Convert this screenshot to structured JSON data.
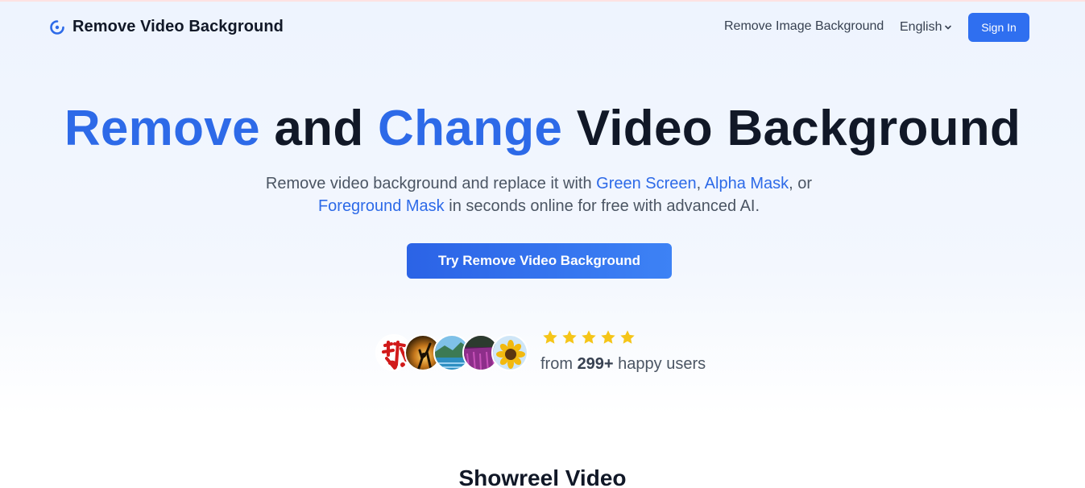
{
  "header": {
    "brand": "Remove Video Background",
    "nav_link": "Remove Image Background",
    "language": "English",
    "sign_in": "Sign In"
  },
  "hero": {
    "title_word1": "Remove",
    "title_word2": " and ",
    "title_word3": "Change",
    "title_word4": " Video Background",
    "sub_part1": "Remove video background and replace it with ",
    "link_green": "Green Screen",
    "sub_part2": ", ",
    "link_alpha": "Alpha Mask",
    "sub_part3": ", or ",
    "link_foreground": "Foreground Mask",
    "sub_part4": " in seconds online for free with advanced AI.",
    "cta": "Try Remove Video Background"
  },
  "social_proof": {
    "rating_stars": 5,
    "from": "from ",
    "count": "299+",
    "suffix": " happy users",
    "avatars": [
      "red-calligraphy-avatar",
      "sunset-silhouette-avatar",
      "lake-landscape-avatar",
      "purple-field-avatar",
      "sunflower-avatar"
    ]
  },
  "showreel": {
    "title": "Showreel Video"
  },
  "colors": {
    "accent": "#2d6ae8",
    "button": "#2f6ff0",
    "star": "#f5c518"
  }
}
